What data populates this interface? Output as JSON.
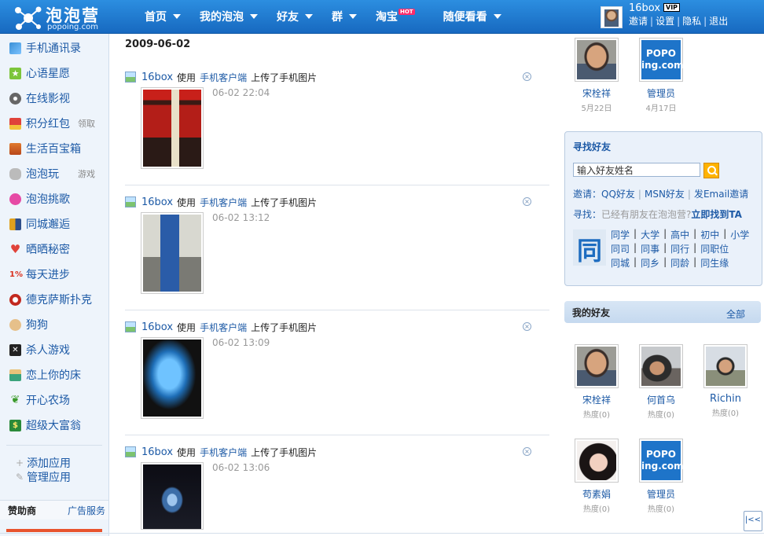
{
  "header": {
    "logo_title": "泡泡营",
    "logo_domain": "popoing.com",
    "nav": [
      {
        "label": "首页",
        "has_caret": true
      },
      {
        "label": "我的泡泡",
        "has_caret": true
      },
      {
        "label": "好友",
        "has_caret": true
      },
      {
        "label": "群",
        "has_caret": true
      },
      {
        "label": "淘宝",
        "has_caret": false,
        "badge": "HOT"
      },
      {
        "label": "随便看看",
        "has_caret": true
      }
    ],
    "user": {
      "name": "16box",
      "vip": "VIP",
      "links": [
        "邀请",
        "设置",
        "隐私",
        "退出"
      ]
    }
  },
  "sidebar": {
    "apps": [
      {
        "label": "手机通讯录",
        "icon": "phone-book-icon",
        "color": "#3a8fd6"
      },
      {
        "label": "心语星愿",
        "icon": "star-icon",
        "color": "#7cc53a"
      },
      {
        "label": "在线影视",
        "icon": "film-reel-icon",
        "color": "#666666"
      },
      {
        "label": "积分红包",
        "icon": "red-envelope-icon",
        "color": "#e0433a",
        "extra": "领取"
      },
      {
        "label": "生活百宝箱",
        "icon": "treasure-box-icon",
        "color": "#d9601e"
      },
      {
        "label": "泡泡玩",
        "icon": "gamepad-icon",
        "color": "#888888",
        "extra": "游戏"
      },
      {
        "label": "泡泡挑歌",
        "icon": "music-note-icon",
        "color": "#e64aa5"
      },
      {
        "label": "同城邂逅",
        "icon": "couple-icon",
        "color": "#e0a11e"
      },
      {
        "label": "晒晒秘密",
        "icon": "heart-icon",
        "color": "#e0433a"
      },
      {
        "label": "每天进步",
        "icon": "percent-icon",
        "color": "#d9301e",
        "glyph": "1%"
      },
      {
        "label": "德克萨斯扑克",
        "icon": "poker-chip-icon",
        "color": "#c2281e"
      },
      {
        "label": "狗狗",
        "icon": "dog-icon",
        "color": "#c9892f"
      },
      {
        "label": "杀人游戏",
        "icon": "skull-icon",
        "color": "#222222"
      },
      {
        "label": "恋上你的床",
        "icon": "bed-icon",
        "color": "#3aa37c"
      },
      {
        "label": "开心农场",
        "icon": "sprout-icon",
        "color": "#3a9a2a"
      },
      {
        "label": "超级大富翁",
        "icon": "money-icon",
        "color": "#2a8a3a"
      }
    ],
    "actions": [
      "添加应用",
      "管理应用"
    ],
    "sponsor_label": "赞助商",
    "ad_link": "广告服务"
  },
  "feed": {
    "date": "2009-06-02",
    "items": [
      {
        "user": "16box",
        "verb": "使用",
        "via": "手机客户端",
        "action": "上传了手机图片",
        "time": "06-02 22:04",
        "photo": "storefront-photo"
      },
      {
        "user": "16box",
        "verb": "使用",
        "via": "手机客户端",
        "action": "上传了手机图片",
        "time": "06-02 13:12",
        "photo": "banner-stand-photo"
      },
      {
        "user": "16box",
        "verb": "使用",
        "via": "手机客户端",
        "action": "上传了手机图片",
        "time": "06-02 13:09",
        "photo": "laptop-photo"
      },
      {
        "user": "16box",
        "verb": "使用",
        "via": "手机客户端",
        "action": "上传了手机图片",
        "time": "06-02 13:06",
        "photo": "dark-sign-photo"
      }
    ]
  },
  "right": {
    "visitors": [
      {
        "name": "宋栓祥",
        "sub": "5月22日",
        "photo": "man-glasses"
      },
      {
        "name": "管理员",
        "sub": "4月17日",
        "photo": "popo-logo"
      }
    ],
    "popo_text": [
      "POPO",
      "ing.com"
    ],
    "find": {
      "title": "寻找好友",
      "placeholder": "输入好友姓名",
      "invite_label": "邀请：",
      "invite_links": [
        "QQ好友",
        "MSN好友",
        "发Email邀请"
      ],
      "search_label": "寻找：",
      "search_question": "已经有朋友在泡泡营?",
      "search_cta": "立即找到TA",
      "tong_glyph": "同",
      "categories": [
        [
          "同学",
          "大学",
          "高中",
          "初中",
          "小学"
        ],
        [
          "同司",
          "同事",
          "同行",
          "同职位"
        ],
        [
          "同城",
          "同乡",
          "同龄",
          "同生缘"
        ]
      ]
    },
    "my_friends_title": "我的好友",
    "my_friends_all": "全部",
    "friends": [
      {
        "name": "宋栓祥",
        "sub": "热度(0)",
        "photo": "man-glasses"
      },
      {
        "name": "何首乌",
        "sub": "热度(0)",
        "photo": "man-outdoor"
      },
      {
        "name": "Richin",
        "sub": "热度(0)",
        "photo": "man-landscape"
      },
      {
        "name": "苟素娟",
        "sub": "热度(0)",
        "photo": "woman-portrait"
      },
      {
        "name": "管理员",
        "sub": "热度(0)",
        "photo": "popo-logo"
      }
    ]
  },
  "collapse_glyph": "|<<"
}
